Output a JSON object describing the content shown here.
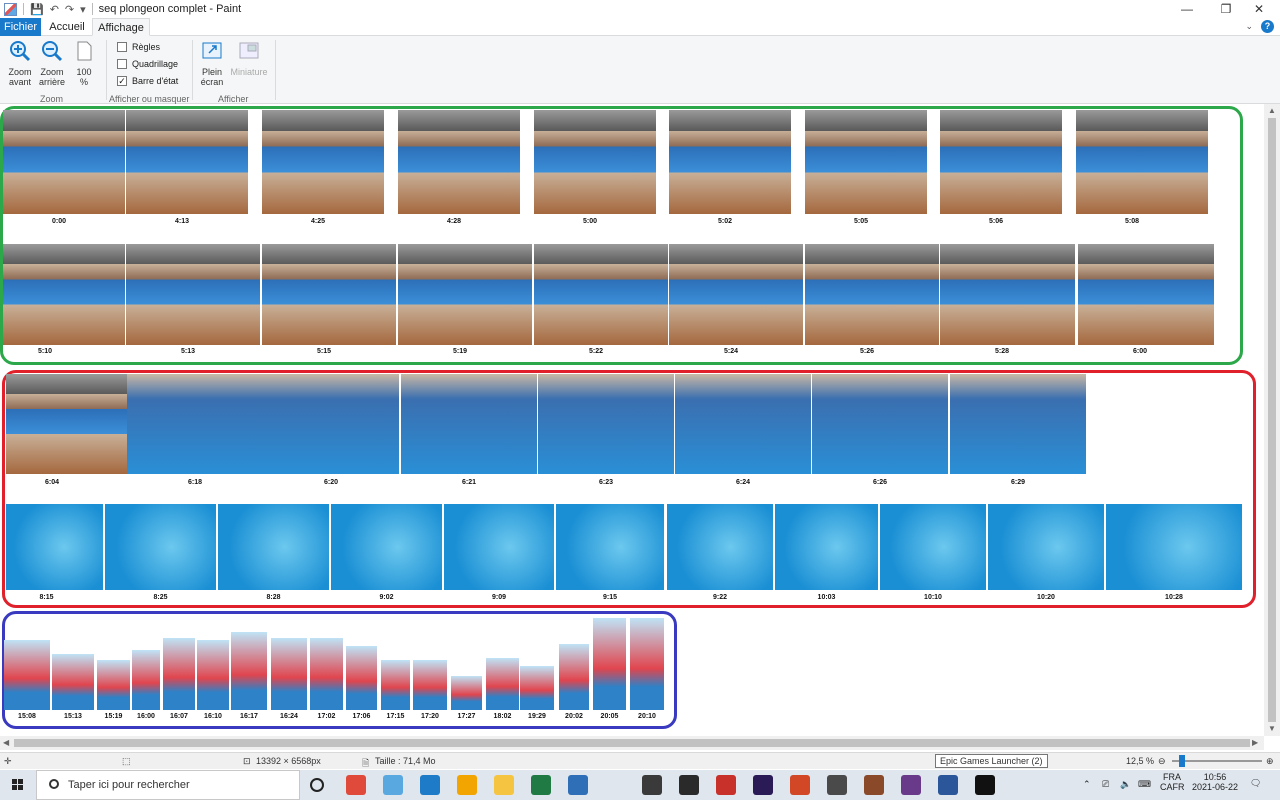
{
  "window": {
    "title": "seq plongeon complet - Paint",
    "minimize": "—",
    "maximize": "❐",
    "close": "✕"
  },
  "tabs": {
    "file": "Fichier",
    "home": "Accueil",
    "view": "Affichage"
  },
  "ribbon": {
    "zoom_in_line1": "Zoom",
    "zoom_in_line2": "avant",
    "zoom_out_line1": "Zoom",
    "zoom_out_line2": "arrière",
    "zoom100_line1": "100",
    "zoom100_line2": "%",
    "group_zoom": "Zoom",
    "rulers": "Règles",
    "gridlines": "Quadrillage",
    "statusbar": "Barre d'état",
    "group_show": "Afficher ou masquer",
    "fullscreen_line1": "Plein",
    "fullscreen_line2": "écran",
    "thumbnail": "Miniature",
    "group_display": "Afficher"
  },
  "frames": {
    "green": {
      "row1": [
        "0:00",
        "4:13",
        "4:25",
        "4:28",
        "5:00",
        "5:02",
        "5:05",
        "5:06",
        "5:08"
      ],
      "row2": [
        "5:10",
        "5:13",
        "5:15",
        "5:19",
        "5:22",
        "5:24",
        "5:26",
        "5:28",
        "6:00"
      ]
    },
    "red": {
      "row1": [
        "6:04",
        "6:18",
        "6:20",
        "6:21",
        "6:23",
        "6:24",
        "6:26",
        "6:29"
      ],
      "row2": [
        "8:15",
        "8:25",
        "8:28",
        "9:02",
        "9:09",
        "9:15",
        "9:22",
        "10:03",
        "10:10",
        "10:20",
        "10:28"
      ]
    },
    "blue": {
      "row1": [
        "15:08",
        "15:13",
        "15:19",
        "16:00",
        "16:07",
        "16:10",
        "16:17",
        "16:24",
        "17:02",
        "17:06",
        "17:15",
        "17:20",
        "17:27",
        "18:02",
        "19:29",
        "20:02",
        "20:05",
        "20:10"
      ]
    }
  },
  "status": {
    "dimensions": "13392 × 6568px",
    "size": "Taille : 71,4 Mo",
    "zoom": "12,5 %",
    "tooltip": "Epic Games Launcher (2)"
  },
  "taskbar": {
    "search_placeholder": "Taper ici pour rechercher",
    "lang1": "FRA",
    "lang2": "CAFR",
    "time": "10:56",
    "date": "2021-06-22"
  },
  "colors": {
    "accent": "#1979ca",
    "green_frame": "#2ca84a",
    "red_frame": "#e0202a",
    "blue_frame": "#3a3ac0"
  }
}
